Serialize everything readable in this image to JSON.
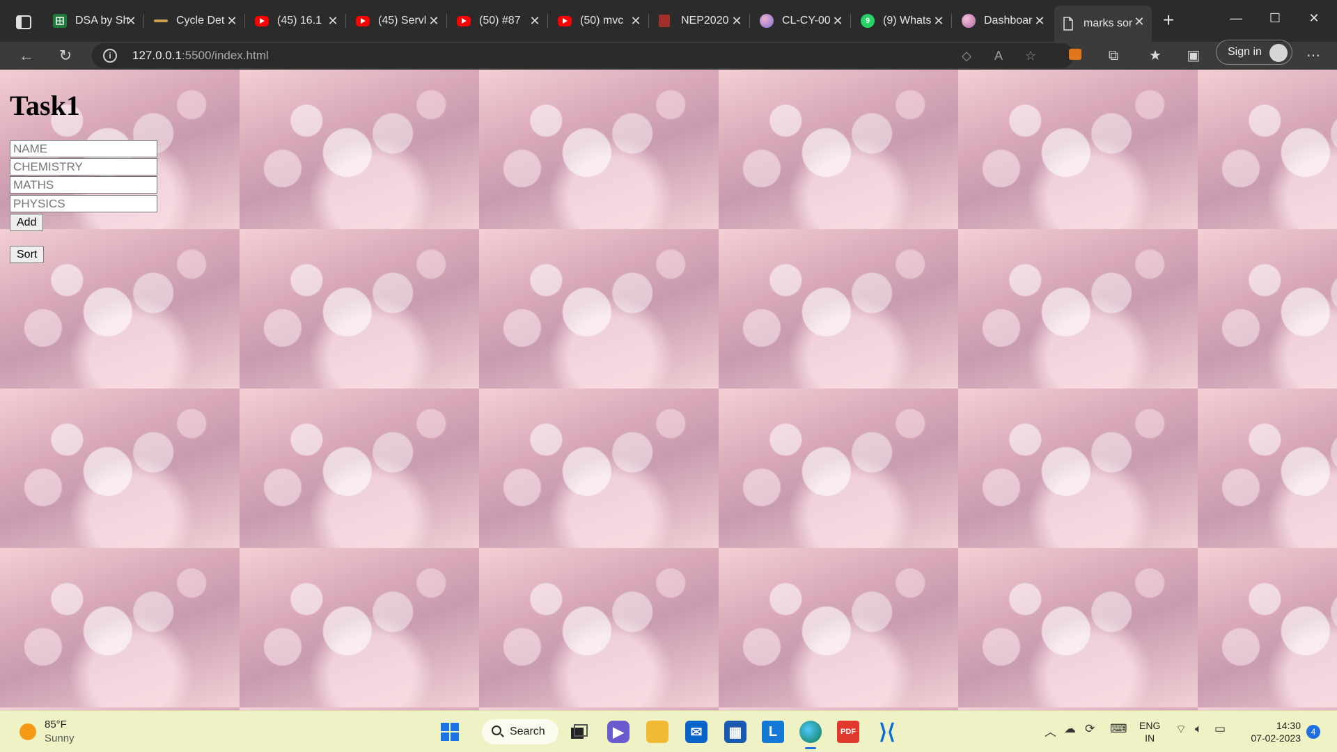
{
  "browser": {
    "tabs": [
      {
        "title": "DSA by Sh",
        "favicon": "sheets-icon",
        "color": "#1f7a3e"
      },
      {
        "title": "Cycle Det",
        "favicon": "site-icon",
        "color": "#5a4a2a"
      },
      {
        "title": "(45) 16.1",
        "favicon": "youtube-icon",
        "color": "#ff0000"
      },
      {
        "title": "(45) Servl",
        "favicon": "youtube-icon",
        "color": "#ff0000"
      },
      {
        "title": "(50) #87",
        "favicon": "youtube-icon",
        "color": "#ff0000"
      },
      {
        "title": "(50) mvc",
        "favicon": "youtube-icon",
        "color": "#ff0000"
      },
      {
        "title": "NEP2020",
        "favicon": "pdf-icon",
        "color": "#a0302a"
      },
      {
        "title": "CL-CY-00",
        "favicon": "colab-icon",
        "color": "#9b7fd6"
      },
      {
        "title": "(9) Whats",
        "favicon": "whatsapp-icon",
        "color": "#25d366"
      },
      {
        "title": "Dashboar",
        "favicon": "dashboard-icon",
        "color": "#c97aa8"
      },
      {
        "title": "marks sor",
        "favicon": "page-icon",
        "color": "#3b3b3b",
        "active": true
      }
    ],
    "url_host": "127.0.0.1",
    "url_path": ":5500/index.html",
    "sign_in": "Sign in"
  },
  "page": {
    "title": "Task1",
    "inputs": [
      {
        "placeholder": "NAME"
      },
      {
        "placeholder": "CHEMISTRY"
      },
      {
        "placeholder": "MATHS"
      },
      {
        "placeholder": "PHYSICS"
      }
    ],
    "add_label": "Add",
    "sort_label": "Sort"
  },
  "taskbar": {
    "temperature": "85°F",
    "weather": "Sunny",
    "search_label": "Search",
    "lang_primary": "ENG",
    "lang_secondary": "IN",
    "time": "14:30",
    "date": "07-02-2023",
    "notifications": "4"
  }
}
